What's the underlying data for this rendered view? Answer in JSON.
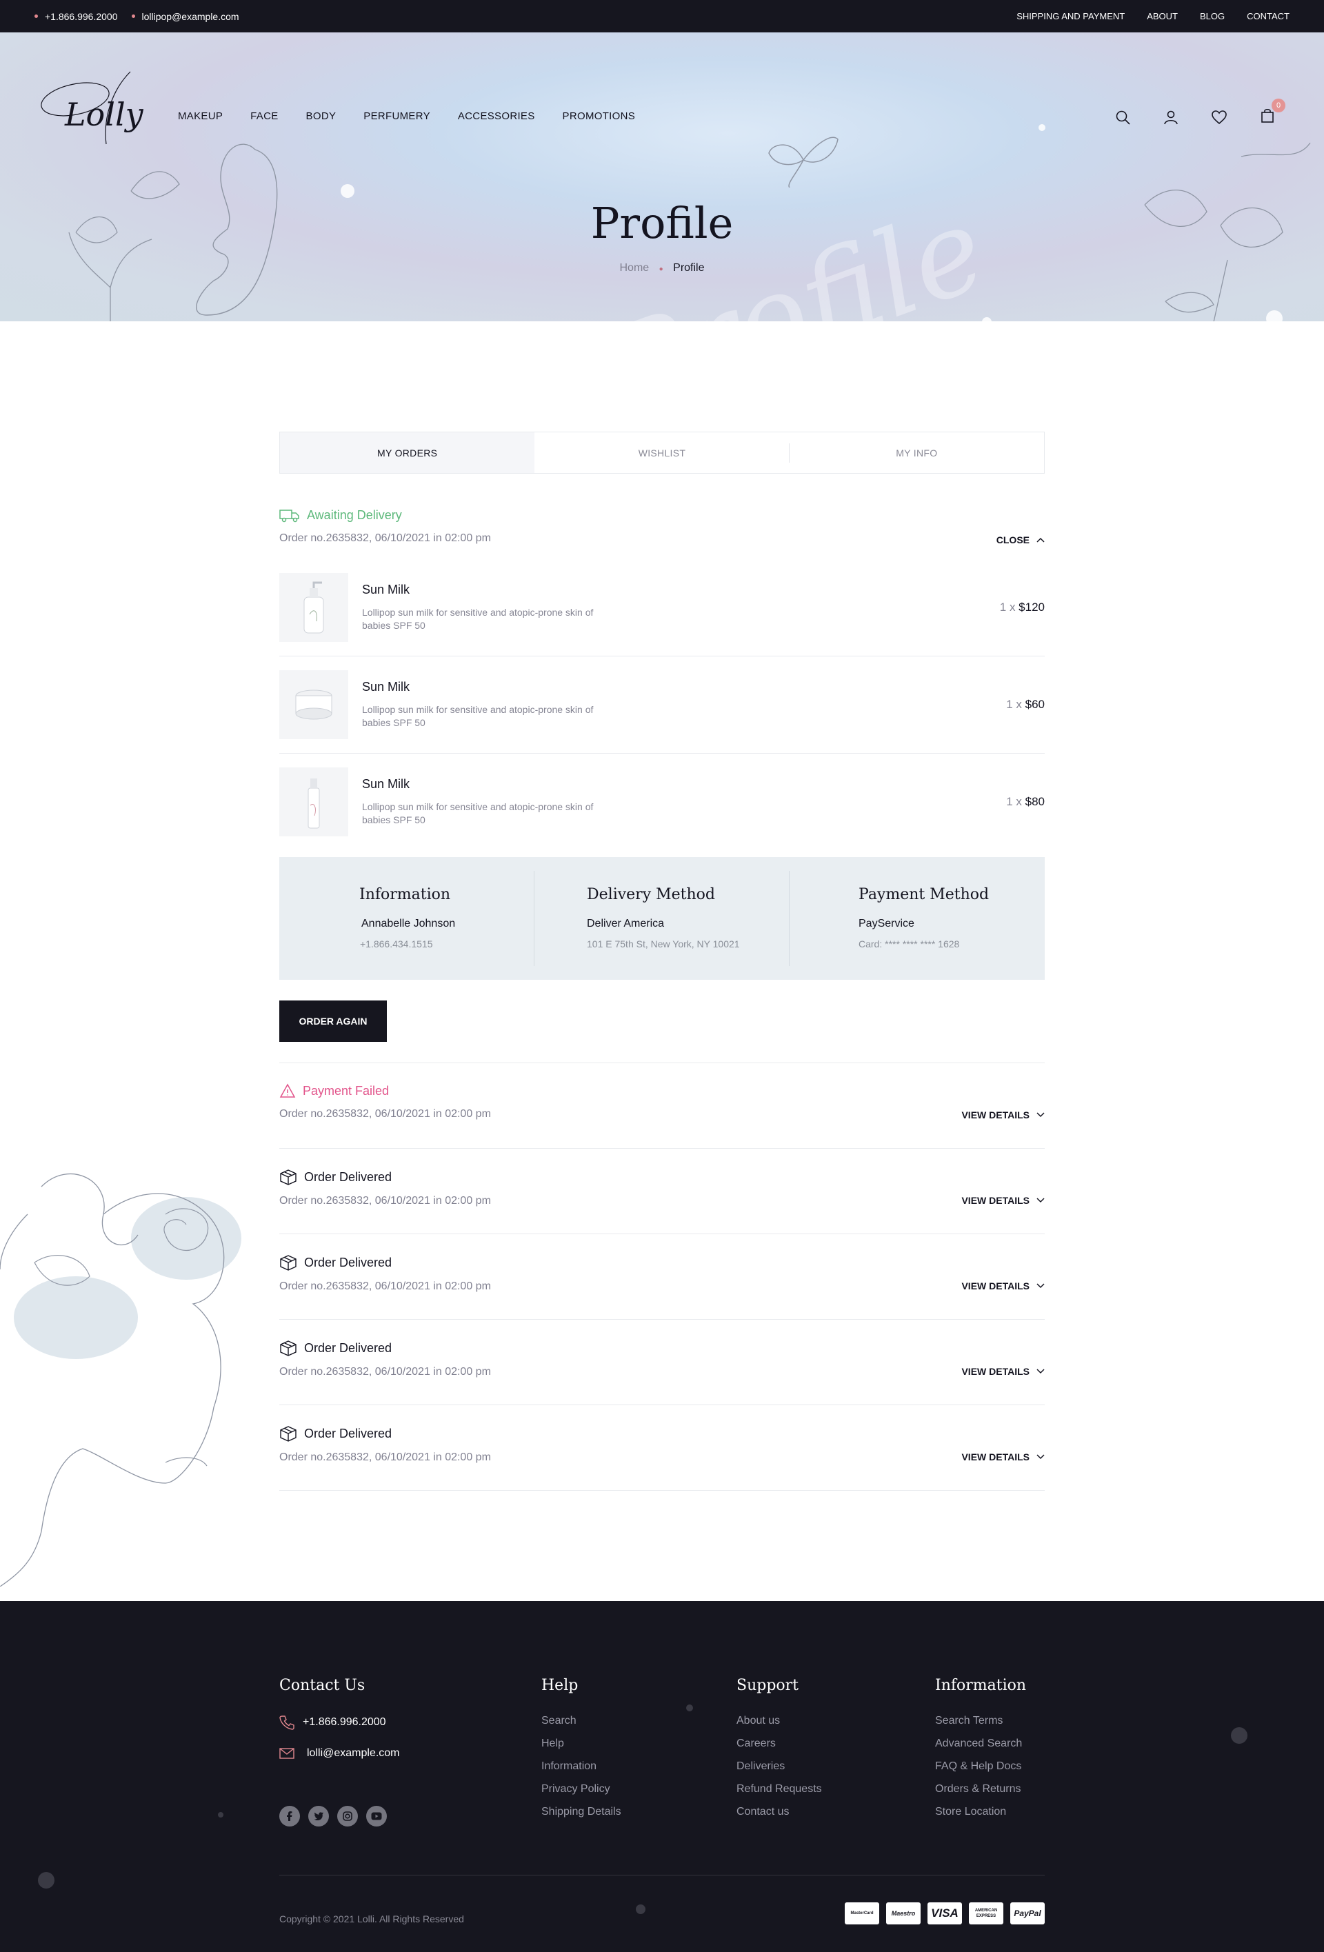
{
  "topbar": {
    "phone": "+1.866.996.2000",
    "email": "lollipop@example.com",
    "links": [
      "SHIPPING AND PAYMENT",
      "ABOUT",
      "BLOG",
      "CONTACT"
    ]
  },
  "brand": {
    "logo": "Lolly"
  },
  "menu": [
    "MAKEUP",
    "FACE",
    "BODY",
    "PERFUMERY",
    "ACCESSORIES",
    "PROMOTIONS"
  ],
  "cart": {
    "count": "0"
  },
  "hero": {
    "title": "Profile",
    "watermark": "Profile",
    "breadcrumb": {
      "home": "Home",
      "current": "Profile"
    }
  },
  "tabs": [
    "MY ORDERS",
    "WISHLIST",
    "MY INFO"
  ],
  "orders": {
    "first": {
      "status": "Awaiting Delivery",
      "meta": "Order no.2635832, 06/10/2021 in 02:00 pm",
      "action": "CLOSE",
      "items": [
        {
          "name": "Sun Milk",
          "desc": "Lollipop sun milk for sensitive and atopic-prone skin of babies SPF 50",
          "qty": "1",
          "price": "$120"
        },
        {
          "name": "Sun Milk",
          "desc": "Lollipop sun milk for sensitive and atopic-prone skin of babies SPF 50",
          "qty": "1",
          "price": "$60"
        },
        {
          "name": "Sun Milk",
          "desc": "Lollipop sun milk for sensitive and atopic-prone skin of babies SPF 50",
          "qty": "1",
          "price": "$80"
        }
      ],
      "info": {
        "title": "Information",
        "name": "Annabelle Johnson",
        "phone": "+1.866.434.1515"
      },
      "delivery": {
        "title": "Delivery Method",
        "name": "Deliver America",
        "address": "101 E 75th St, New York, NY 10021"
      },
      "payment": {
        "title": "Payment Method",
        "name": "PayService",
        "card": "Card:  **** **** **** 1628"
      },
      "button": "ORDER AGAIN"
    },
    "failed": {
      "status": "Payment Failed",
      "meta": "Order no.2635832, 06/10/2021 in 02:00 pm",
      "action": "VIEW DETAILS"
    },
    "delivered": [
      {
        "status": "Order Delivered",
        "meta": "Order no.2635832, 06/10/2021 in 02:00 pm",
        "action": "VIEW DETAILS"
      },
      {
        "status": "Order Delivered",
        "meta": "Order no.2635832, 06/10/2021 in 02:00 pm",
        "action": "VIEW DETAILS"
      },
      {
        "status": "Order Delivered",
        "meta": "Order no.2635832, 06/10/2021 in 02:00 pm",
        "action": "VIEW DETAILS"
      },
      {
        "status": "Order Delivered",
        "meta": "Order no.2635832, 06/10/2021 in 02:00 pm",
        "action": "VIEW DETAILS"
      }
    ]
  },
  "footer": {
    "contact": {
      "title": "Contact Us",
      "phone": "+1.866.996.2000",
      "email": "lolli@example.com"
    },
    "help": {
      "title": "Help",
      "links": [
        "Search",
        "Help",
        "Information",
        "Privacy Policy",
        "Shipping Details"
      ]
    },
    "support": {
      "title": "Support",
      "links": [
        "About us",
        "Careers",
        "Deliveries",
        "Refund Requests",
        "Contact us"
      ]
    },
    "information": {
      "title": "Information",
      "links": [
        "Search Terms",
        "Advanced Search",
        "FAQ & Help Docs",
        "Orders & Returns",
        "Store Location"
      ]
    },
    "copyright": "Copyright © 2021 Lolli.  All Rights Reserved",
    "payments": [
      "MasterCard",
      "Maestro",
      "VISA",
      "AMERICAN EXPRESS",
      "PayPal"
    ]
  },
  "colors": {
    "dark": "#16161f",
    "green": "#5cb87a",
    "pink": "#e2538a",
    "accent": "#e49494"
  }
}
